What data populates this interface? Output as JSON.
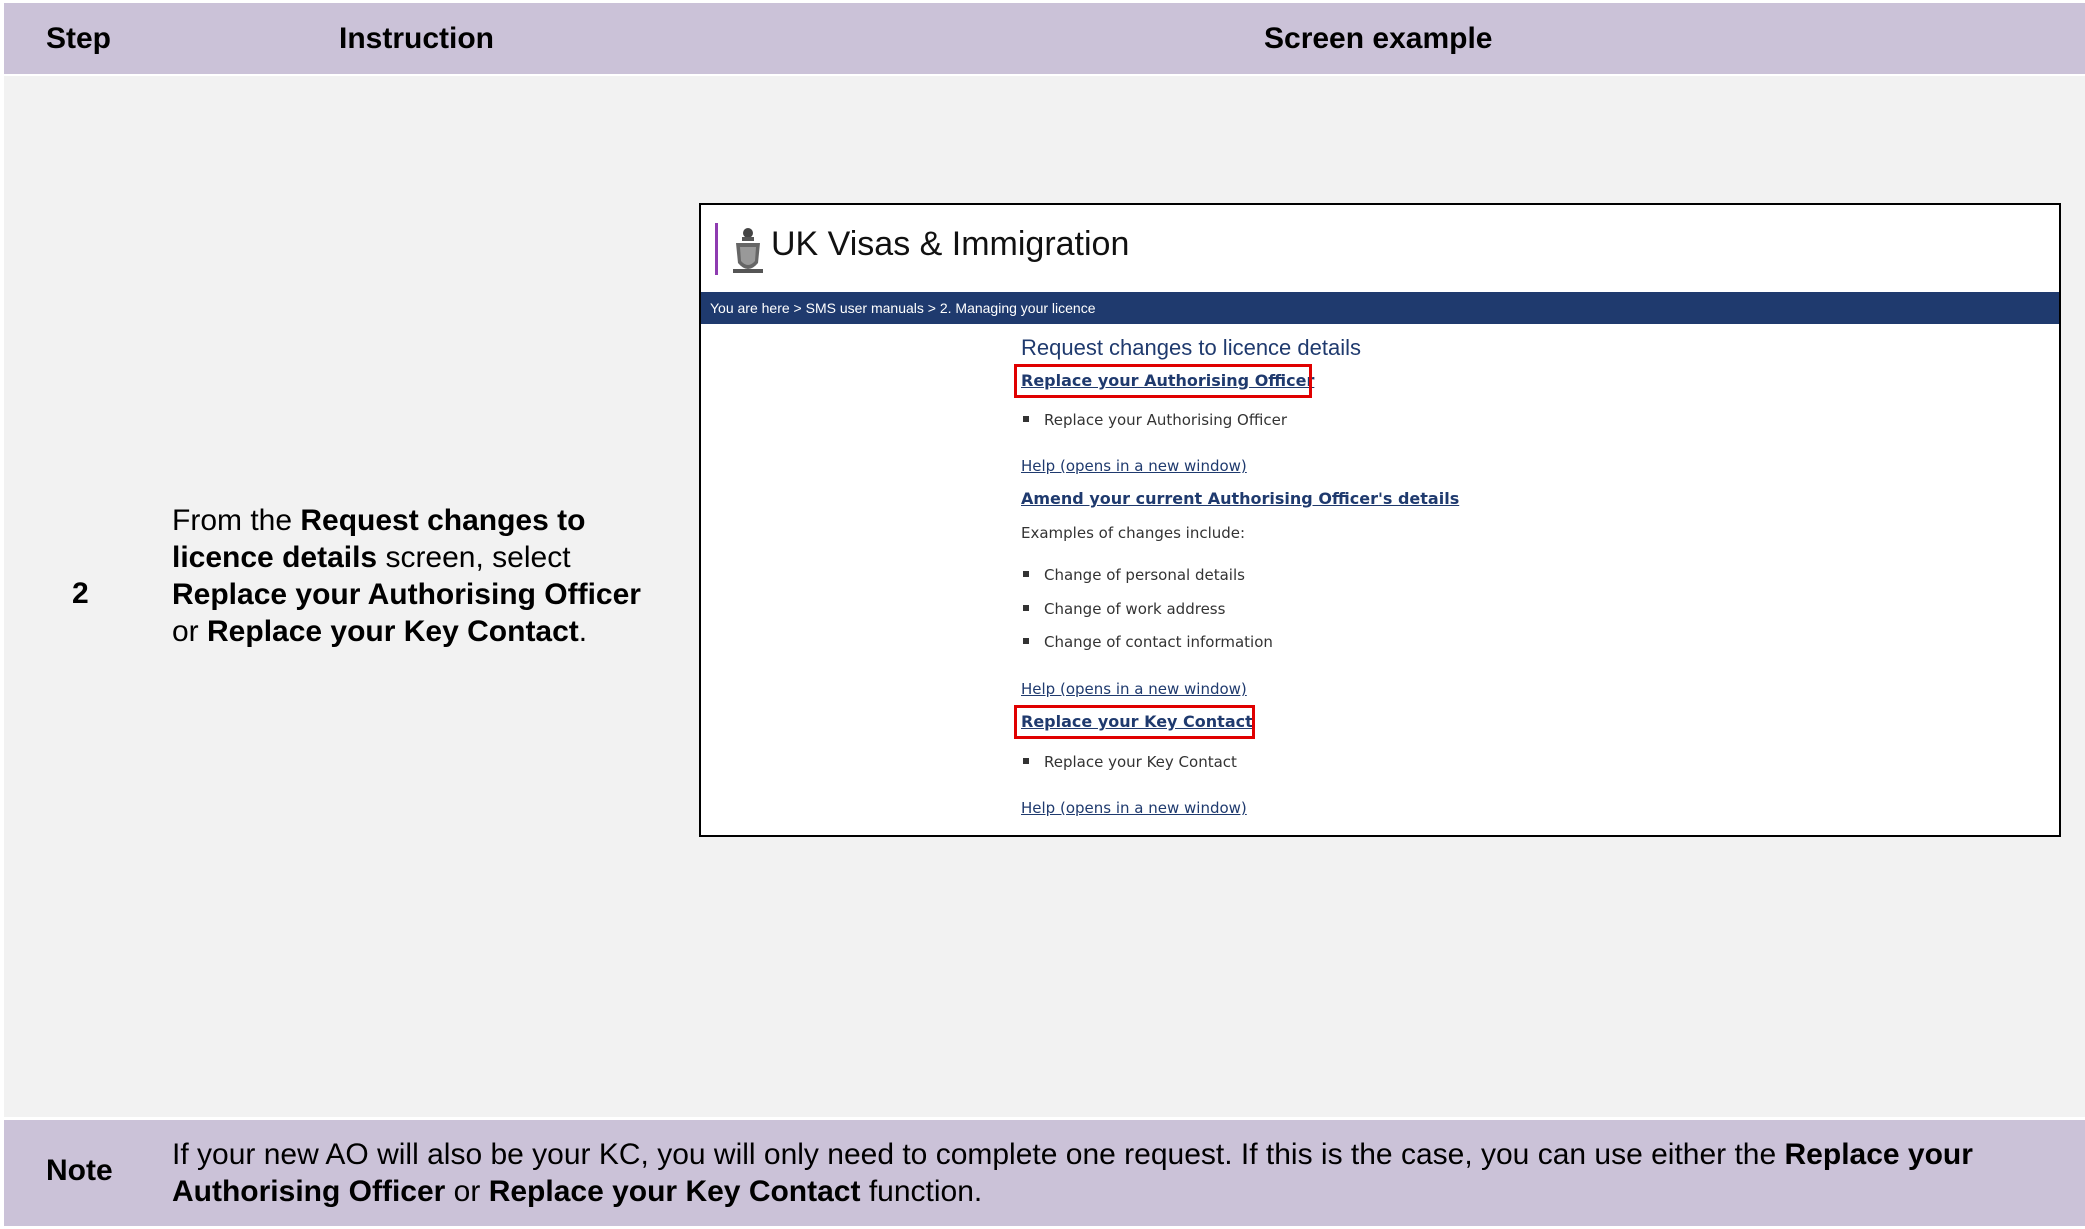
{
  "table": {
    "headers": {
      "step": "Step",
      "instruction": "Instruction",
      "screen_example": "Screen example"
    },
    "row": {
      "step_number": "2",
      "instruction_parts": [
        {
          "text": "From the ",
          "bold": false
        },
        {
          "text": "Request changes to licence details",
          "bold": true
        },
        {
          "text": " screen, select ",
          "bold": false
        },
        {
          "text": "Replace your Authorising Officer",
          "bold": true
        },
        {
          "text": " or ",
          "bold": false
        },
        {
          "text": "Replace your Key Contact",
          "bold": true
        },
        {
          "text": ".",
          "bold": false
        }
      ]
    },
    "note": {
      "label": "Note",
      "parts": [
        {
          "text": "If your new AO will also be your KC, you will only need to complete one request. If this is the case, you can use either the ",
          "bold": false
        },
        {
          "text": "Replace your Authorising Officer",
          "bold": true
        },
        {
          "text": " or ",
          "bold": false
        },
        {
          "text": "Replace your Key Contact",
          "bold": true
        },
        {
          "text": " function.",
          "bold": false
        }
      ]
    }
  },
  "screen": {
    "brand_name": "UK Visas & Immigration",
    "crest_icon": "royal-crest-icon",
    "breadcrumb": "You are here > SMS user manuals > 2. Managing your licence",
    "page_title": "Request changes to licence details",
    "sections": {
      "authorising_officer": {
        "link": "Replace your Authorising Officer",
        "bullet": "Replace your Authorising Officer",
        "help": "Help (opens in a new window)"
      },
      "amend": {
        "link": "Amend your current Authorising Officer's details",
        "intro": "Examples of changes include:",
        "bullets": [
          "Change of personal details",
          "Change of work address",
          "Change of contact information"
        ],
        "help": "Help (opens in a new window)"
      },
      "key_contact": {
        "link": "Replace your Key Contact",
        "bullet": "Replace your Key Contact",
        "help": "Help (opens in a new window)"
      }
    },
    "colors": {
      "brand_bar": "#8e3bb0",
      "nav_bar": "#1f3a6e",
      "highlight": "#e00000",
      "table_header": "#cbc2d8"
    }
  }
}
